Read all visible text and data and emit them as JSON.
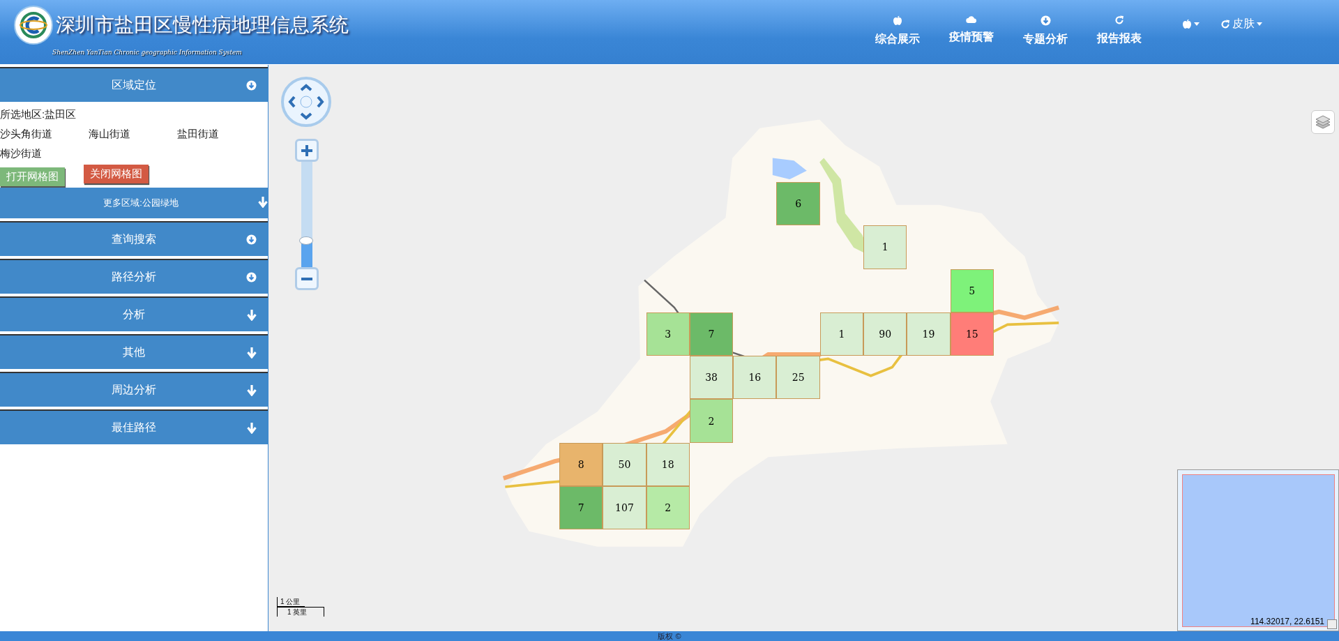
{
  "header": {
    "title": "深圳市盐田区慢性病地理信息系统",
    "subtitle": "ShenZhen YanTian Chronic geographic Information System",
    "nav": [
      {
        "label": "综合展示"
      },
      {
        "label": "疫情预警"
      },
      {
        "label": "专题分析"
      },
      {
        "label": "报告报表"
      }
    ],
    "skin_label": "皮肤"
  },
  "sidebar": {
    "sections": [
      {
        "title": "区域定位",
        "selected_area": "所选地区:盐田区",
        "streets": [
          "沙头角街道",
          "海山街道",
          "盐田街道",
          "梅沙街道"
        ],
        "buttons": [
          {
            "label": "打开网格图",
            "kind": "open"
          },
          {
            "label": "关闭网格图",
            "kind": "close"
          }
        ],
        "sub_title": "更多区域:公园绿地"
      },
      {
        "title": "查询搜索"
      },
      {
        "title": "路径分析"
      },
      {
        "title": "分析"
      },
      {
        "title": "其他"
      },
      {
        "title": "周边分析"
      },
      {
        "title": "最佳路径"
      }
    ]
  },
  "map": {
    "zoom": {
      "level": 0.25
    },
    "grid_cells": [
      [
        null,
        null,
        null,
        null,
        null,
        {
          "count": "6",
          "color": "#6cba68"
        },
        null,
        null,
        null,
        null
      ],
      [
        null,
        null,
        null,
        null,
        null,
        null,
        null,
        {
          "count": "1",
          "color": "#d9eed3"
        },
        null,
        null
      ],
      [
        null,
        null,
        null,
        null,
        null,
        null,
        null,
        null,
        null,
        {
          "count": "5",
          "color": "#7ef27a"
        }
      ],
      [
        null,
        null,
        {
          "count": "3",
          "color": "#a6e296"
        },
        {
          "count": "7",
          "color": "#6cba68"
        },
        null,
        null,
        {
          "count": "1",
          "color": "#d9eed3"
        },
        {
          "count": "90",
          "color": "#d9eed3"
        },
        {
          "count": "19",
          "color": "#d9eed3"
        },
        {
          "count": "15",
          "color": "#ff7d78"
        }
      ],
      [
        null,
        null,
        null,
        {
          "count": "38",
          "color": "#d9eed3"
        },
        {
          "count": "16",
          "color": "#d9eed3"
        },
        {
          "count": "25",
          "color": "#d9eed3"
        },
        null,
        null,
        null,
        null
      ],
      [
        null,
        null,
        null,
        {
          "count": "2",
          "color": "#a6e296"
        },
        null,
        null,
        null,
        null,
        null,
        null
      ],
      [
        {
          "count": "8",
          "color": "#e8b46c"
        },
        {
          "count": "50",
          "color": "#d9eed3"
        },
        {
          "count": "18",
          "color": "#d9eed3"
        },
        null,
        null,
        null,
        null,
        null,
        null,
        null
      ],
      [
        {
          "count": "7",
          "color": "#6cba68"
        },
        {
          "count": "107",
          "color": "#d9eed3"
        },
        {
          "count": "2",
          "color": "#b6eaa6"
        },
        null,
        null,
        null,
        null,
        null,
        null,
        null
      ]
    ],
    "scale_km": "1 公里",
    "scale_mi": "1 英里",
    "coordinates": "114.32017, 22.6151"
  },
  "footer": {
    "text": "版权 ©"
  }
}
